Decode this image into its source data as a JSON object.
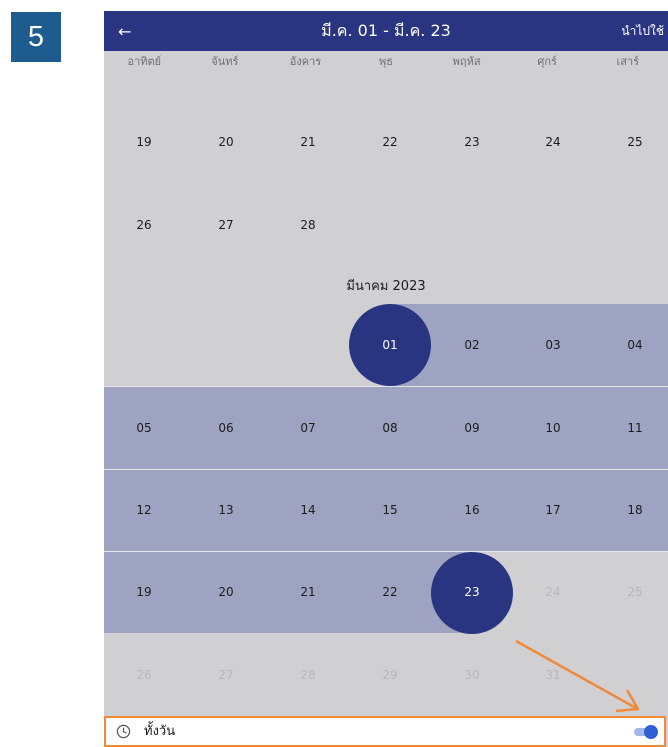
{
  "step_number": "5",
  "header": {
    "back_icon": "arrow-left-icon",
    "back_glyph": "←",
    "title": "มี.ค. 01 - มี.ค. 23",
    "apply_label": "นำไปใช้"
  },
  "weekdays": [
    "อาทิตย์",
    "จันทร์",
    "อังคาร",
    "พุธ",
    "พฤหัส",
    "ศุกร์",
    "เสาร์"
  ],
  "february": {
    "week_a": [
      "19",
      "20",
      "21",
      "22",
      "23",
      "24",
      "25"
    ],
    "week_b": [
      "26",
      "27",
      "28"
    ]
  },
  "march": {
    "label": "มีนาคม 2023",
    "week1": [
      "01",
      "02",
      "03",
      "04"
    ],
    "week2": [
      "05",
      "06",
      "07",
      "08",
      "09",
      "10",
      "11"
    ],
    "week3": [
      "12",
      "13",
      "14",
      "15",
      "16",
      "17",
      "18"
    ],
    "week4": [
      "19",
      "20",
      "21",
      "22",
      "23",
      "24",
      "25"
    ],
    "week5": [
      "26",
      "27",
      "28",
      "29",
      "30",
      "31"
    ]
  },
  "selection": {
    "start": "01",
    "end": "23"
  },
  "all_day": {
    "label": "ทั้งวัน",
    "icon": "clock-icon",
    "toggled_on": true
  },
  "colors": {
    "accent": "#2a3582",
    "range": "#9ea3c2",
    "callout": "#f08a3a",
    "badge": "#1e5c8f"
  }
}
